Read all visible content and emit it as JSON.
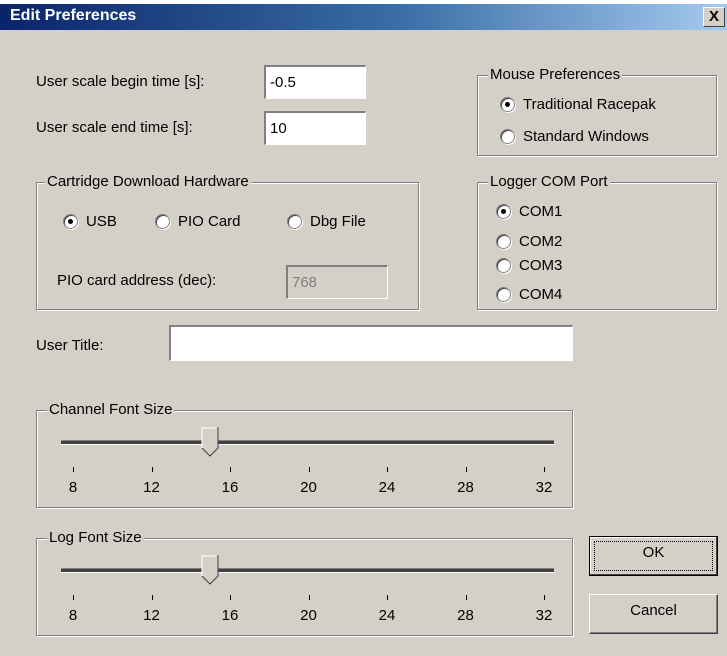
{
  "window": {
    "title": "Edit Preferences",
    "close_glyph": "X"
  },
  "scale": {
    "begin_label": "User scale begin time [s]:",
    "begin_value": "-0.5",
    "end_label": "User scale end time [s]:",
    "end_value": "10"
  },
  "mouse": {
    "legend": "Mouse Preferences",
    "options": [
      {
        "label": "Traditional Racepak",
        "checked": true
      },
      {
        "label": "Standard Windows",
        "checked": false
      }
    ]
  },
  "cartridge": {
    "legend": "Cartridge Download Hardware",
    "options": [
      {
        "label": "USB",
        "checked": true
      },
      {
        "label": "PIO Card",
        "checked": false
      },
      {
        "label": "Dbg File",
        "checked": false
      }
    ],
    "pio_label": "PIO card address (dec):",
    "pio_value": "768"
  },
  "com": {
    "legend": "Logger COM Port",
    "options": [
      {
        "label": "COM1",
        "checked": true
      },
      {
        "label": "COM2",
        "checked": false
      },
      {
        "label": "COM3",
        "checked": false
      },
      {
        "label": "COM4",
        "checked": false
      }
    ]
  },
  "user_title": {
    "label": "User Title:",
    "value": ""
  },
  "channel_font": {
    "legend": "Channel Font Size",
    "ticks": [
      "8",
      "12",
      "16",
      "20",
      "24",
      "28",
      "32"
    ],
    "value": 15,
    "min": 8,
    "max": 32
  },
  "log_font": {
    "legend": "Log Font Size",
    "ticks": [
      "8",
      "12",
      "16",
      "20",
      "24",
      "28",
      "32"
    ],
    "value": 15,
    "min": 8,
    "max": 32
  },
  "buttons": {
    "ok": "OK",
    "cancel": "Cancel"
  },
  "colors": {
    "face": "#d4d0c8",
    "title_start": "#0a246a",
    "title_end": "#a6caf0"
  }
}
